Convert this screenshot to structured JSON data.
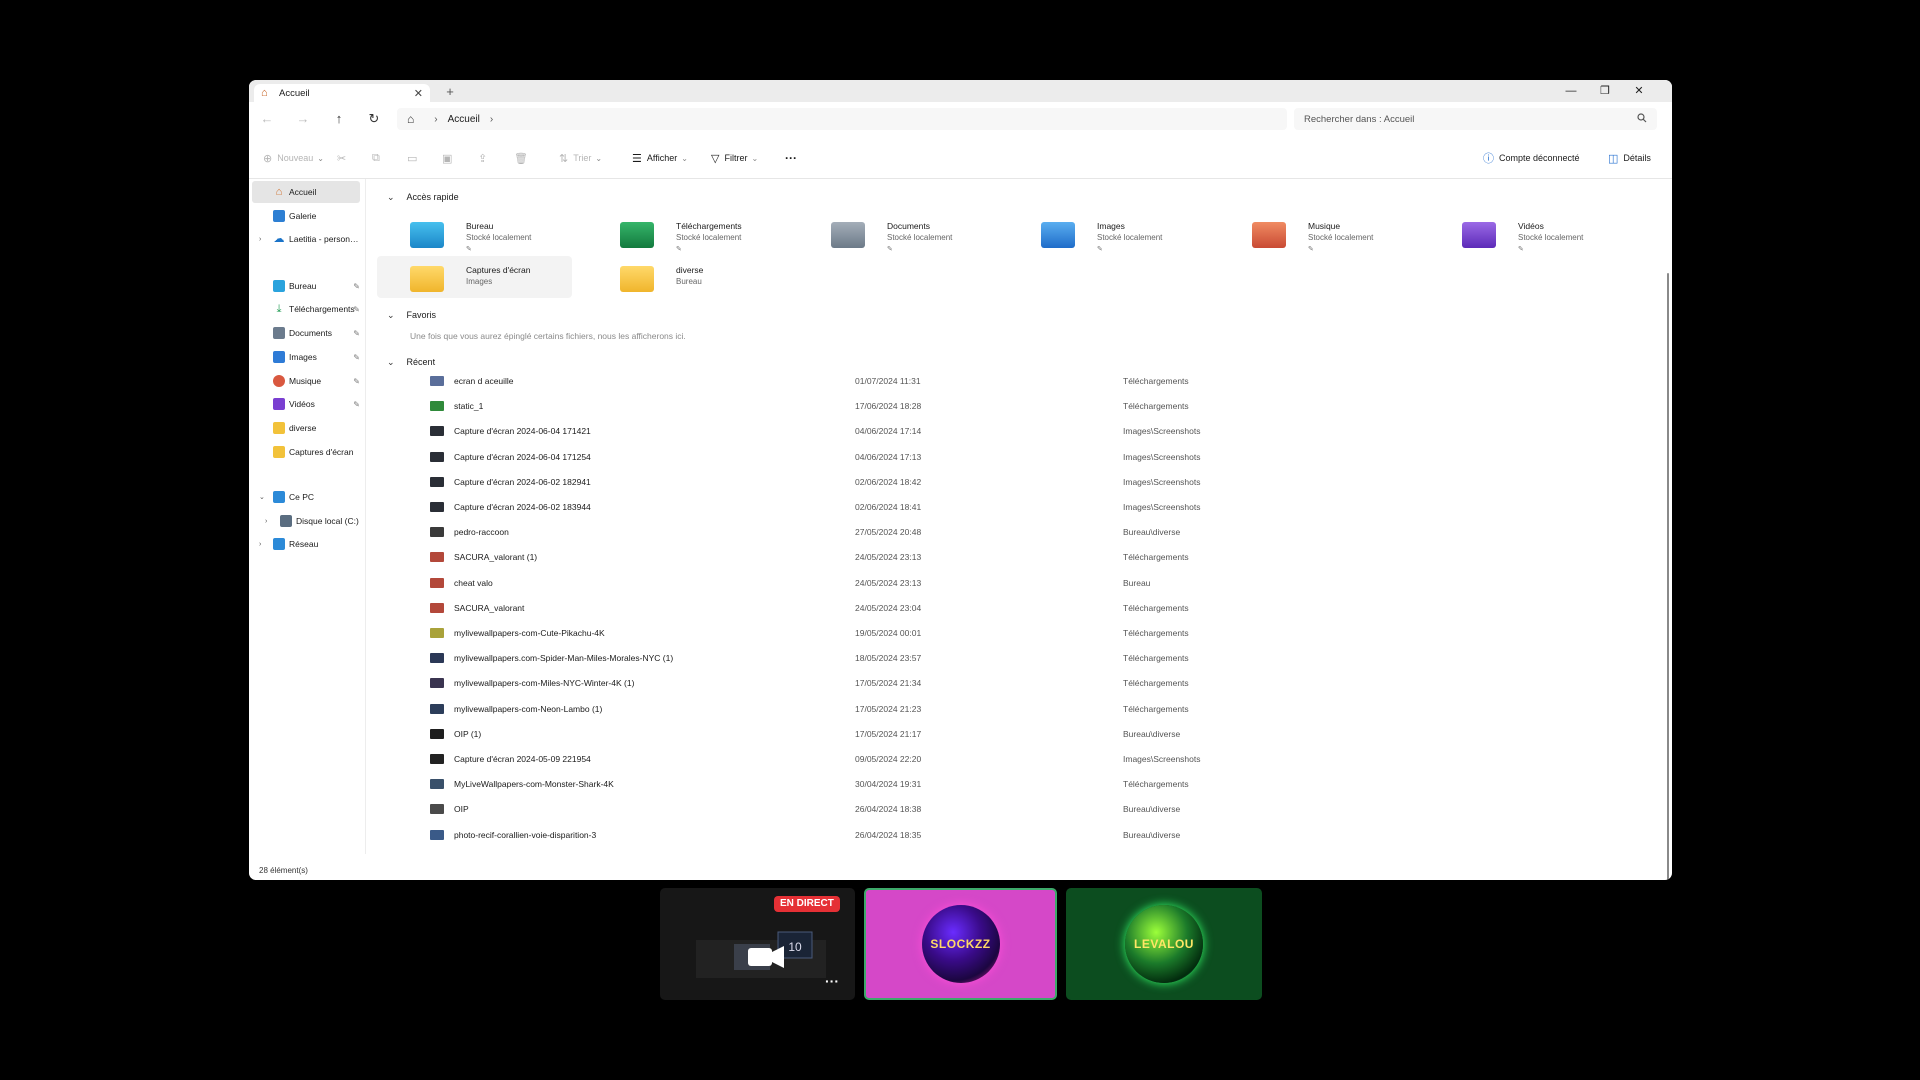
{
  "window": {
    "tab_title": "Accueil",
    "tab_close": "✕",
    "new_tab": "+",
    "controls": {
      "minimize": "—",
      "maximize": "❐",
      "close": "✕"
    }
  },
  "nav": {
    "back": "←",
    "forward": "→",
    "up": "↑",
    "refresh": "↻",
    "breadcrumb": [
      "Accueil"
    ],
    "search_placeholder": "Rechercher dans : Accueil"
  },
  "toolbar": {
    "new_label": "Nouveau",
    "sort_label": "Trier",
    "view_label": "Afficher",
    "filter_label": "Filtrer",
    "more_label": "···",
    "account_label": "Compte déconnecté",
    "details_label": "Détails"
  },
  "sidebar": {
    "items": [
      {
        "label": "Accueil",
        "icon": "home-icon",
        "color": "#d0712e"
      },
      {
        "label": "Galerie",
        "icon": "gallery-icon",
        "color": "#2d7fd3"
      },
      {
        "label": "Laetitia - personnel",
        "icon": "cloud-icon",
        "color": "#1a73c8"
      },
      {
        "label": "Bureau",
        "icon": "desktop-icon",
        "color": "#2aa3dd"
      },
      {
        "label": "Téléchargements",
        "icon": "download-icon",
        "color": "#1e9b52"
      },
      {
        "label": "Documents",
        "icon": "documents-icon",
        "color": "#6b7b8d"
      },
      {
        "label": "Images",
        "icon": "images-icon",
        "color": "#2e7bd6"
      },
      {
        "label": "Musique",
        "icon": "music-icon",
        "color": "#d9583f"
      },
      {
        "label": "Vidéos",
        "icon": "videos-icon",
        "color": "#7a3fd1"
      },
      {
        "label": "diverse",
        "icon": "folder-icon",
        "color": "#f2c23a"
      },
      {
        "label": "Captures d'écran",
        "icon": "folder-icon",
        "color": "#f2c23a"
      },
      {
        "label": "Ce PC",
        "icon": "pc-icon",
        "color": "#2c8ad8"
      },
      {
        "label": "Disque local (C:)",
        "icon": "drive-icon",
        "color": "#5a6d80"
      },
      {
        "label": "Réseau",
        "icon": "network-icon",
        "color": "#2c8ad8"
      }
    ]
  },
  "sections": {
    "quick_access": "Accès rapide",
    "favorites": "Favoris",
    "favorites_note": "Une fois que vous aurez épinglé certains fichiers, nous les afficherons ici.",
    "recent": "Récent"
  },
  "quick_access": [
    {
      "name": "Bureau",
      "sub": "Stocké localement",
      "color": "#2a9fd9"
    },
    {
      "name": "Téléchargements",
      "sub": "Stocké localement",
      "color": "#1f9a55"
    },
    {
      "name": "Documents",
      "sub": "Stocké localement",
      "color": "#7d8a98"
    },
    {
      "name": "Images",
      "sub": "Stocké localement",
      "color": "#2f7fd8"
    },
    {
      "name": "Musique",
      "sub": "Stocké localement",
      "color": "#dd6a4a"
    },
    {
      "name": "Vidéos",
      "sub": "Stocké localement",
      "color": "#7b44d3"
    },
    {
      "name": "Captures d'écran",
      "sub": "Images",
      "color": "#f3c444"
    },
    {
      "name": "diverse",
      "sub": "Bureau",
      "color": "#f3c444"
    }
  ],
  "recent": [
    {
      "name": "ecran d aceuille",
      "date": "01/07/2024 11:31",
      "location": "Téléchargements",
      "thumb": "#5a6e9a"
    },
    {
      "name": "static_1",
      "date": "17/06/2024 18:28",
      "location": "Téléchargements",
      "thumb": "#2f8a3a"
    },
    {
      "name": "Capture d'écran 2024-06-04 171421",
      "date": "04/06/2024 17:14",
      "location": "Images\\Screenshots",
      "thumb": "#2a2e36"
    },
    {
      "name": "Capture d'écran 2024-06-04 171254",
      "date": "04/06/2024 17:13",
      "location": "Images\\Screenshots",
      "thumb": "#2a2e36"
    },
    {
      "name": "Capture d'écran 2024-06-02 182941",
      "date": "02/06/2024 18:42",
      "location": "Images\\Screenshots",
      "thumb": "#2a2e36"
    },
    {
      "name": "Capture d'écran 2024-06-02 183944",
      "date": "02/06/2024 18:41",
      "location": "Images\\Screenshots",
      "thumb": "#2a2e36"
    },
    {
      "name": "pedro-raccoon",
      "date": "27/05/2024 20:48",
      "location": "Bureau\\diverse",
      "thumb": "#3a3a3a"
    },
    {
      "name": "SACURA_valorant (1)",
      "date": "24/05/2024 23:13",
      "location": "Téléchargements",
      "thumb": "#b3483a"
    },
    {
      "name": "cheat valo",
      "date": "24/05/2024 23:13",
      "location": "Bureau",
      "thumb": "#b3483a"
    },
    {
      "name": "SACURA_valorant",
      "date": "24/05/2024 23:04",
      "location": "Téléchargements",
      "thumb": "#b3483a"
    },
    {
      "name": "mylivewallpapers-com-Cute-Pikachu-4K",
      "date": "19/05/2024 00:01",
      "location": "Téléchargements",
      "thumb": "#a9a23a"
    },
    {
      "name": "mylivewallpapers.com-Spider-Man-Miles-Morales-NYC (1)",
      "date": "18/05/2024 23:57",
      "location": "Téléchargements",
      "thumb": "#2b3856"
    },
    {
      "name": "mylivewallpapers-com-Miles-NYC-Winter-4K (1)",
      "date": "17/05/2024 21:34",
      "location": "Téléchargements",
      "thumb": "#3a3450"
    },
    {
      "name": "mylivewallpapers-com-Neon-Lambo (1)",
      "date": "17/05/2024 21:23",
      "location": "Téléchargements",
      "thumb": "#2c3d5a"
    },
    {
      "name": "OIP (1)",
      "date": "17/05/2024 21:17",
      "location": "Bureau\\diverse",
      "thumb": "#1e1e1e"
    },
    {
      "name": "Capture d'écran 2024-05-09 221954",
      "date": "09/05/2024 22:20",
      "location": "Images\\Screenshots",
      "thumb": "#222"
    },
    {
      "name": "MyLiveWallpapers-com-Monster-Shark-4K",
      "date": "30/04/2024 19:31",
      "location": "Téléchargements",
      "thumb": "#39506a"
    },
    {
      "name": "OIP",
      "date": "26/04/2024 18:38",
      "location": "Bureau\\diverse",
      "thumb": "#4a4a4a"
    },
    {
      "name": "photo-recif-corallien-voie-disparition-3",
      "date": "26/04/2024 18:35",
      "location": "Bureau\\diverse",
      "thumb": "#3a5a88"
    }
  ],
  "status": {
    "count": "28 élément(s)"
  },
  "call": {
    "live_badge": "EN DIRECT",
    "more": "···",
    "participant_2": "SLOCKZZ",
    "participant_3": "LEVALOU"
  }
}
